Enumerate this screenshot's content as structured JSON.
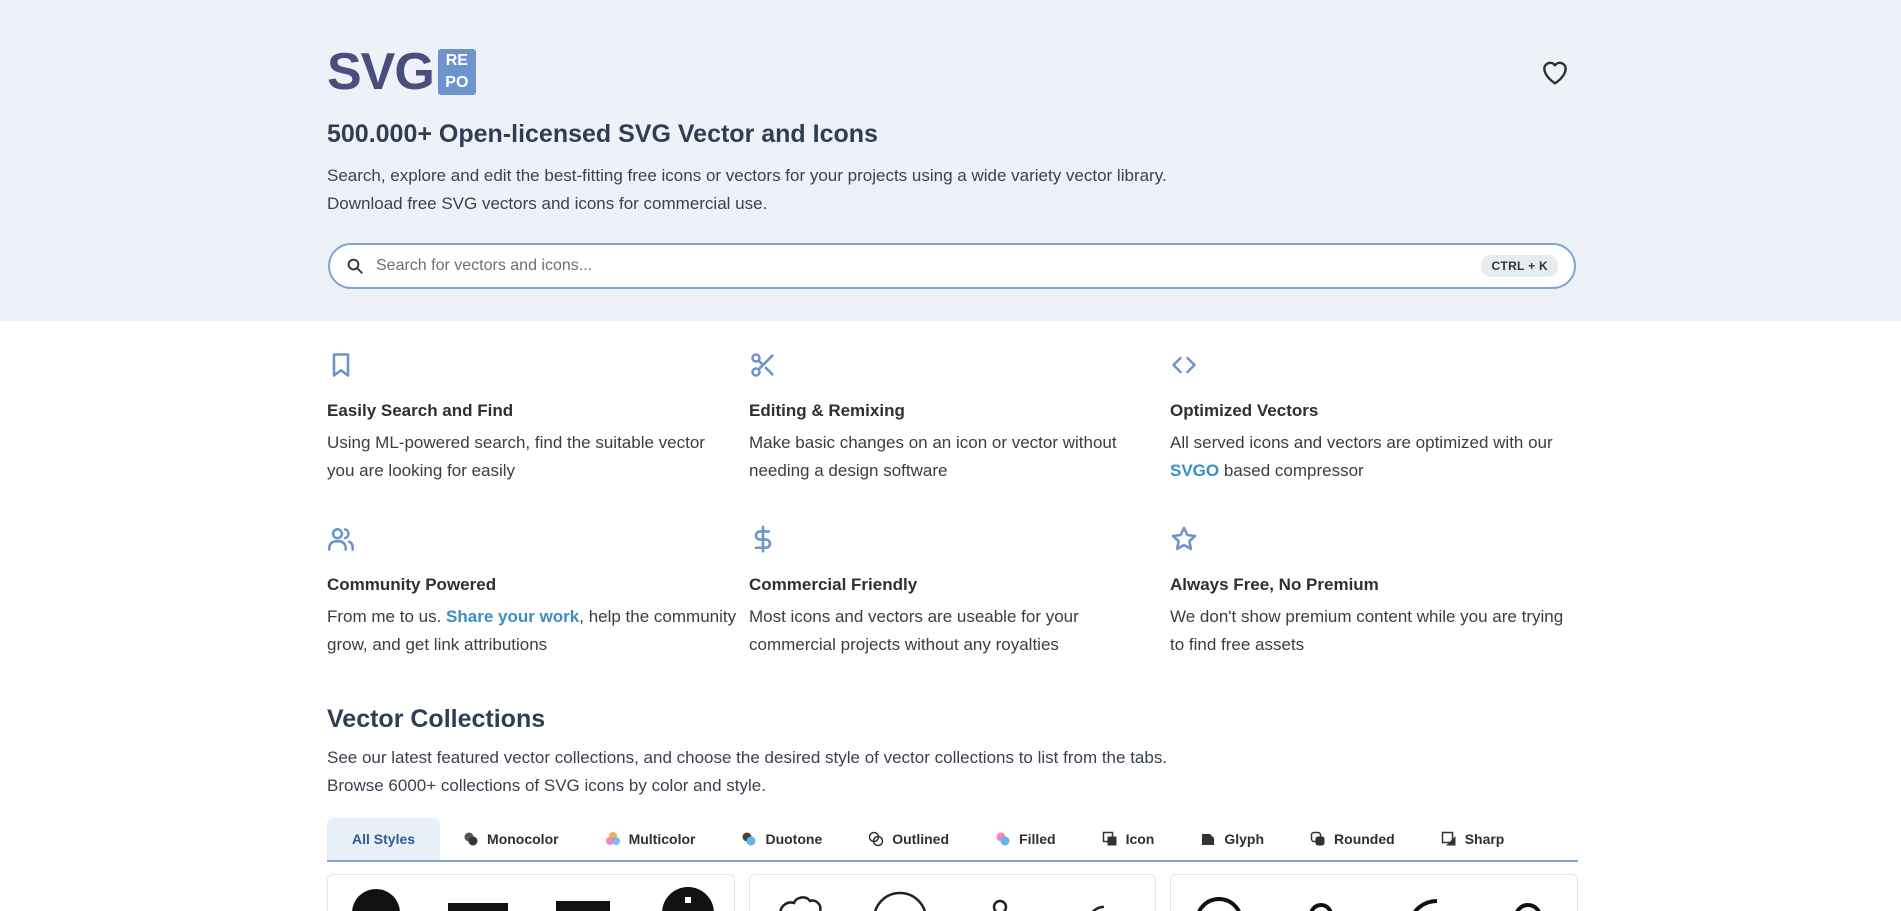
{
  "brand": {
    "logo_main": "SVG",
    "logo_badge": [
      "RE",
      "PO"
    ]
  },
  "header": {
    "favorites_icon": "heart-icon",
    "title": "500.000+ Open-licensed SVG Vector and Icons",
    "subtitle_line1": "Search, explore and edit the best-fitting free icons or vectors for your projects using a wide variety vector library.",
    "subtitle_line2": "Download free SVG vectors and icons for commercial use."
  },
  "search": {
    "placeholder": "Search for vectors and icons...",
    "shortcut": "CTRL + K",
    "icon": "search-icon"
  },
  "accent_color": "#6d94cb",
  "link_color": "#3a8fc0",
  "features": [
    {
      "icon": "bookmark-icon",
      "title": "Easily Search and Find",
      "text": "Using ML-powered search, find the suitable vector you are looking for easily"
    },
    {
      "icon": "scissors-icon",
      "title": "Editing & Remixing",
      "text": "Make basic changes on an icon or vector without needing a design software"
    },
    {
      "icon": "code-icon",
      "title": "Optimized Vectors",
      "text_before": "All served icons and vectors are optimized with our ",
      "link": "SVGO",
      "text_after": " based compressor"
    },
    {
      "icon": "users-icon",
      "title": "Community Powered",
      "text_before": "From me to us. ",
      "link": "Share your work",
      "text_after": ", help the community grow, and get link attributions"
    },
    {
      "icon": "dollar-icon",
      "title": "Commercial Friendly",
      "text": "Most icons and vectors are useable for your commercial projects without any royalties"
    },
    {
      "icon": "star-icon",
      "title": "Always Free, No Premium",
      "text": "We don't show premium content while you are trying to find free assets"
    }
  ],
  "collections": {
    "title": "Vector Collections",
    "subtitle_line1": "See our latest featured vector collections, and choose the desired style of vector collections to list from the tabs.",
    "subtitle_line2": "Browse 6000+ collections of SVG icons by color and style.",
    "tabs": [
      {
        "label": "All Styles",
        "icon": "",
        "active": true
      },
      {
        "label": "Monocolor",
        "icon": "monocolor-icon"
      },
      {
        "label": "Multicolor",
        "icon": "multicolor-icon"
      },
      {
        "label": "Duotone",
        "icon": "duotone-icon"
      },
      {
        "label": "Outlined",
        "icon": "outlined-icon"
      },
      {
        "label": "Filled",
        "icon": "filled-icon"
      },
      {
        "label": "Icon",
        "icon": "icon-style-icon"
      },
      {
        "label": "Glyph",
        "icon": "glyph-icon"
      },
      {
        "label": "Rounded",
        "icon": "rounded-icon"
      },
      {
        "label": "Sharp",
        "icon": "sharp-icon"
      }
    ]
  }
}
